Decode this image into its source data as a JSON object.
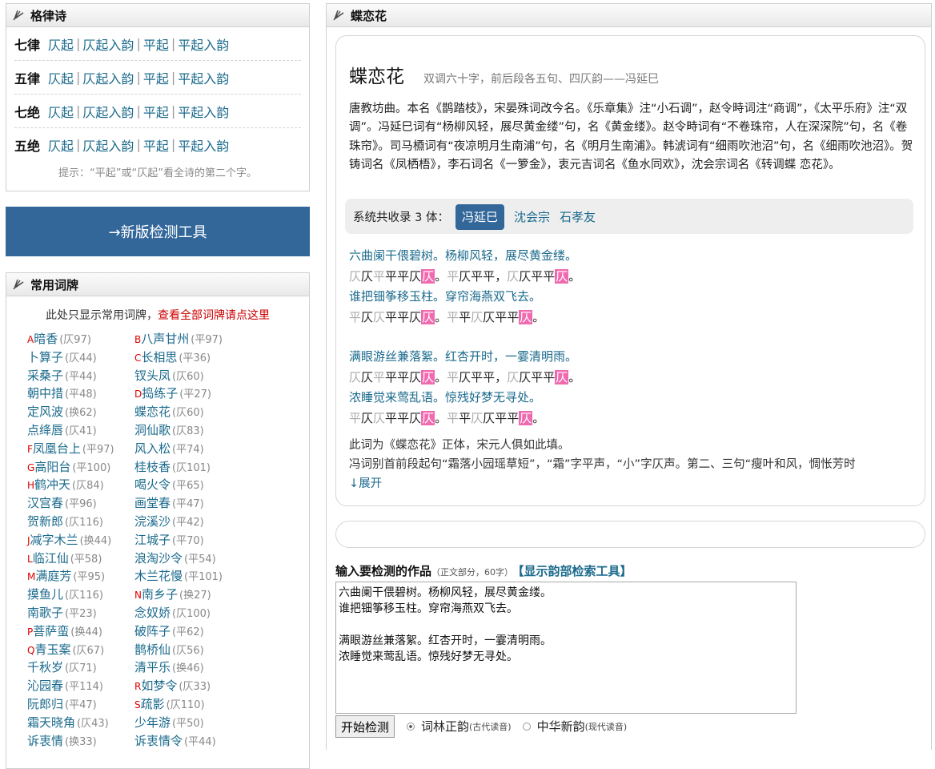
{
  "gelv": {
    "title": "格律诗",
    "rows": [
      {
        "label": "七律",
        "links": [
          "仄起",
          "仄起入韵",
          "平起",
          "平起入韵"
        ]
      },
      {
        "label": "五律",
        "links": [
          "仄起",
          "仄起入韵",
          "平起",
          "平起入韵"
        ]
      },
      {
        "label": "七绝",
        "links": [
          "仄起",
          "仄起入韵",
          "平起",
          "平起入韵"
        ]
      },
      {
        "label": "五绝",
        "links": [
          "仄起",
          "仄起入韵",
          "平起",
          "平起入韵"
        ]
      }
    ],
    "sep": "|",
    "tip": "提示：“平起”或“仄起”看全诗的第二个字。"
  },
  "newtool": {
    "label": "→新版检测工具"
  },
  "cipai": {
    "title": "常用词牌",
    "note": "此处只显示常用词牌，",
    "note_link": "查看全部词牌请点这里",
    "items": [
      {
        "letter": "A",
        "name": "暗香",
        "meta": "(仄97)"
      },
      {
        "letter": "B",
        "name": "八声甘州",
        "meta": "(平97)"
      },
      {
        "letter": "",
        "name": "卜算子",
        "meta": "(仄44)"
      },
      {
        "letter": "C",
        "name": "长相思",
        "meta": "(平36)"
      },
      {
        "letter": "",
        "name": "采桑子",
        "meta": "(平44)"
      },
      {
        "letter": "",
        "name": "钗头凤",
        "meta": "(仄60)"
      },
      {
        "letter": "",
        "name": "朝中措",
        "meta": "(平48)"
      },
      {
        "letter": "D",
        "name": "捣练子",
        "meta": "(平27)"
      },
      {
        "letter": "",
        "name": "定风波",
        "meta": "(换62)"
      },
      {
        "letter": "",
        "name": "蝶恋花",
        "meta": "(仄60)"
      },
      {
        "letter": "",
        "name": "点绛唇",
        "meta": "(仄41)"
      },
      {
        "letter": "",
        "name": "洞仙歌",
        "meta": "(仄83)"
      },
      {
        "letter": "F",
        "name": "凤凰台上",
        "meta": "(平97)"
      },
      {
        "letter": "",
        "name": "风入松",
        "meta": "(平74)"
      },
      {
        "letter": "G",
        "name": "高阳台",
        "meta": "(平100)"
      },
      {
        "letter": "",
        "name": "桂枝香",
        "meta": "(仄101)"
      },
      {
        "letter": "H",
        "name": "鹤冲天",
        "meta": "(仄84)"
      },
      {
        "letter": "",
        "name": "喝火令",
        "meta": "(平65)"
      },
      {
        "letter": "",
        "name": "汉宫春",
        "meta": "(平96)"
      },
      {
        "letter": "",
        "name": "画堂春",
        "meta": "(平47)"
      },
      {
        "letter": "",
        "name": "贺新郎",
        "meta": "(仄116)"
      },
      {
        "letter": "",
        "name": "浣溪沙",
        "meta": "(平42)"
      },
      {
        "letter": "J",
        "name": "减字木兰",
        "meta": "(换44)"
      },
      {
        "letter": "",
        "name": "江城子",
        "meta": "(平70)"
      },
      {
        "letter": "L",
        "name": "临江仙",
        "meta": "(平58)"
      },
      {
        "letter": "",
        "name": "浪淘沙令",
        "meta": "(平54)"
      },
      {
        "letter": "M",
        "name": "满庭芳",
        "meta": "(平95)"
      },
      {
        "letter": "",
        "name": "木兰花慢",
        "meta": "(平101)"
      },
      {
        "letter": "",
        "name": "摸鱼儿",
        "meta": "(仄116)"
      },
      {
        "letter": "N",
        "name": "南乡子",
        "meta": "(换27)"
      },
      {
        "letter": "",
        "name": "南歌子",
        "meta": "(平23)"
      },
      {
        "letter": "",
        "name": "念奴娇",
        "meta": "(仄100)"
      },
      {
        "letter": "P",
        "name": "菩萨蛮",
        "meta": "(换44)"
      },
      {
        "letter": "",
        "name": "破阵子",
        "meta": "(平62)"
      },
      {
        "letter": "Q",
        "name": "青玉案",
        "meta": "(仄67)"
      },
      {
        "letter": "",
        "name": "鹊桥仙",
        "meta": "(仄56)"
      },
      {
        "letter": "",
        "name": "千秋岁",
        "meta": "(仄71)"
      },
      {
        "letter": "",
        "name": "清平乐",
        "meta": "(换46)"
      },
      {
        "letter": "",
        "name": "沁园春",
        "meta": "(平114)"
      },
      {
        "letter": "R",
        "name": "如梦令",
        "meta": "(仄33)"
      },
      {
        "letter": "",
        "name": "阮郎归",
        "meta": "(平47)"
      },
      {
        "letter": "S",
        "name": "疏影",
        "meta": "(仄110)"
      },
      {
        "letter": "",
        "name": "霜天晓角",
        "meta": "(仄43)"
      },
      {
        "letter": "",
        "name": "少年游",
        "meta": "(平50)"
      },
      {
        "letter": "",
        "name": "诉衷情",
        "meta": "(换33)"
      },
      {
        "letter": "",
        "name": "诉衷情令",
        "meta": "(平44)"
      }
    ]
  },
  "main": {
    "title": "蝶恋花",
    "card_title": "蝶恋花",
    "card_sub": "双调六十字，前后段各五句、四仄韵——冯延巳",
    "intro": "唐教坊曲。本名《鹊踏枝》，宋晏殊词改今名。《乐章集》注“小石调”，赵令畤词注“商调”，《太平乐府》注“双调”。冯延巳词有“杨柳风轻，展尽黄金缕”句，名《黄金缕》。赵令畤词有“不卷珠帘，人在深深院”句，名《卷珠帘》。司马槱词有“夜凉明月生南浦”句，名《明月生南浦》。韩淲词有“细雨吹池沼”句，名《细雨吹池沼》。贺铸词名《凤栖梧》，李石词名《一箩金》，衷元吉词名《鱼水同欢》，沈会宗词名《转调蝶 恋花》。",
    "collect_label": "系统共收录 3 体：",
    "authors": [
      "冯延巳",
      "沈会宗",
      "石孝友"
    ],
    "active_author": "冯延巳",
    "poem": [
      {
        "text": "六曲阑干偎碧树。杨柳风轻，展尽黄金缕。",
        "tones": [
          [
            "仄",
            "off"
          ],
          [
            "仄",
            "on"
          ],
          [
            "平",
            "off"
          ],
          [
            "平",
            "on"
          ],
          [
            "平",
            "on"
          ],
          [
            "仄",
            "on"
          ],
          [
            "仄",
            "rhyme"
          ],
          [
            "。",
            "on"
          ],
          [
            "平",
            "off"
          ],
          [
            "仄",
            "on"
          ],
          [
            "平",
            "on"
          ],
          [
            "平",
            "on"
          ],
          [
            "，",
            "on"
          ],
          [
            "仄",
            "off"
          ],
          [
            "仄",
            "on"
          ],
          [
            "平",
            "on"
          ],
          [
            "平",
            "on"
          ],
          [
            "仄",
            "rhyme"
          ],
          [
            "。",
            "on"
          ]
        ]
      },
      {
        "text": "谁把钿筝移玉柱。穿帘海燕双飞去。",
        "tones": [
          [
            "平",
            "off"
          ],
          [
            "仄",
            "on"
          ],
          [
            "仄",
            "off"
          ],
          [
            "平",
            "on"
          ],
          [
            "平",
            "on"
          ],
          [
            "仄",
            "on"
          ],
          [
            "仄",
            "rhyme"
          ],
          [
            "。",
            "on"
          ],
          [
            "平",
            "off"
          ],
          [
            "平",
            "on"
          ],
          [
            "仄",
            "off"
          ],
          [
            "仄",
            "on"
          ],
          [
            "平",
            "on"
          ],
          [
            "平",
            "on"
          ],
          [
            "仄",
            "rhyme"
          ],
          [
            "。",
            "on"
          ]
        ]
      },
      {
        "text": "满眼游丝兼落絮。红杏开时，一霎清明雨。",
        "tones": [
          [
            "仄",
            "off"
          ],
          [
            "仄",
            "on"
          ],
          [
            "平",
            "off"
          ],
          [
            "平",
            "on"
          ],
          [
            "平",
            "on"
          ],
          [
            "仄",
            "on"
          ],
          [
            "仄",
            "rhyme"
          ],
          [
            "。",
            "on"
          ],
          [
            "平",
            "off"
          ],
          [
            "仄",
            "on"
          ],
          [
            "平",
            "on"
          ],
          [
            "平",
            "on"
          ],
          [
            "，",
            "on"
          ],
          [
            "仄",
            "off"
          ],
          [
            "仄",
            "on"
          ],
          [
            "平",
            "on"
          ],
          [
            "平",
            "on"
          ],
          [
            "仄",
            "rhyme"
          ],
          [
            "。",
            "on"
          ]
        ]
      },
      {
        "text": "浓睡觉来莺乱语。惊残好梦无寻处。",
        "tones": [
          [
            "平",
            "off"
          ],
          [
            "仄",
            "on"
          ],
          [
            "仄",
            "off"
          ],
          [
            "平",
            "on"
          ],
          [
            "平",
            "on"
          ],
          [
            "仄",
            "on"
          ],
          [
            "仄",
            "rhyme"
          ],
          [
            "。",
            "on"
          ],
          [
            "平",
            "off"
          ],
          [
            "平",
            "on"
          ],
          [
            "仄",
            "off"
          ],
          [
            "仄",
            "on"
          ],
          [
            "平",
            "on"
          ],
          [
            "平",
            "on"
          ],
          [
            "仄",
            "rhyme"
          ],
          [
            "。",
            "on"
          ]
        ]
      }
    ],
    "note1": "此词为《蝶恋花》正体，宋元人俱如此填。",
    "note2": "冯词别首前段起句“霜落小园瑶草短”，“霜”字平声，“小”字仄声。第二、三句“瘦叶和风，惆怅芳时",
    "expand": "↓展开",
    "input_label": "输入要检测的作品",
    "input_hint": "（正文部分，60字）",
    "input_link": "【显示韵部检索工具】",
    "work_text": "六曲阑干偎碧树。杨柳风轻，展尽黄金缕。\n谁把钿筝移玉柱。穿帘海燕双飞去。\n\n满眼游丝兼落絮。红杏开时，一霎清明雨。\n浓睡觉来莺乱语。惊残好梦无寻处。",
    "submit": "开始检测",
    "radio1": "词林正韵",
    "radio1_hint": "(古代读音)",
    "radio2": "中华新韵",
    "radio2_hint": "(现代读音)"
  }
}
